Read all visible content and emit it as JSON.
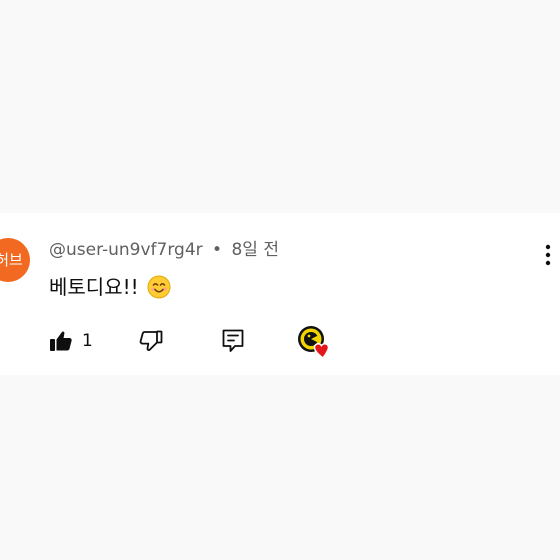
{
  "comment": {
    "avatar_text": "허브",
    "author": "@user-un9vf7rg4r",
    "separator": "•",
    "time": "8일 전",
    "text": "베토디요!!",
    "emoji": "smiling-face-icon",
    "like_count": "1"
  },
  "icons": {
    "more": "more-vertical-icon",
    "like": "thumbs-up-filled-icon",
    "dislike": "thumbs-down-outline-icon",
    "reply": "reply-comment-icon",
    "creator_heart": "creator-heart-badge-icon"
  },
  "colors": {
    "avatar": "#f26a21",
    "heart": "#e3161b",
    "badge_yellow": "#f3d400",
    "text_primary": "#0f0f0f",
    "text_secondary": "#606060"
  }
}
